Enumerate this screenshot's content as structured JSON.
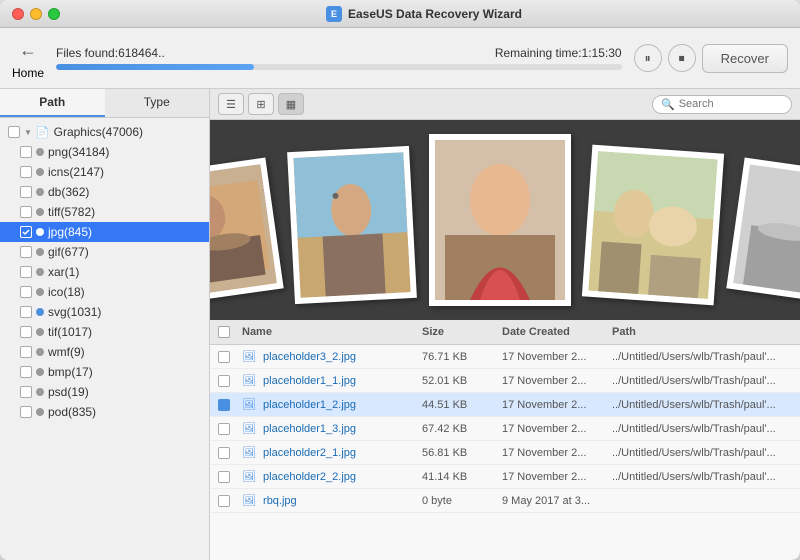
{
  "window": {
    "title": "EaseUS Data Recovery Wizard",
    "title_icon": "E"
  },
  "topbar": {
    "back_label": "←",
    "home_label": "Home",
    "files_found_label": "Files found:",
    "files_found_value": "618464..",
    "remaining_label": "Remaining time:",
    "remaining_value": "1:15:30",
    "progress_percent": 35,
    "pause_label": "⏸",
    "stop_label": "⏹",
    "recover_label": "Recover"
  },
  "sidebar": {
    "tab_path": "Path",
    "tab_type": "Type",
    "items": [
      {
        "label": "Graphics(47006)",
        "indent": 0,
        "type": "parent",
        "icon": "📄",
        "has_arrow": true
      },
      {
        "label": "png(34184)",
        "indent": 1,
        "type": "child",
        "dot_color": "#999"
      },
      {
        "label": "icns(2147)",
        "indent": 1,
        "type": "child",
        "dot_color": "#999"
      },
      {
        "label": "db(362)",
        "indent": 1,
        "type": "child",
        "dot_color": "#999"
      },
      {
        "label": "tiff(5782)",
        "indent": 1,
        "type": "child",
        "dot_color": "#999"
      },
      {
        "label": "jpg(845)",
        "indent": 1,
        "type": "child",
        "dot_color": "#333",
        "selected": true
      },
      {
        "label": "gif(677)",
        "indent": 1,
        "type": "child",
        "dot_color": "#999"
      },
      {
        "label": "xar(1)",
        "indent": 1,
        "type": "child",
        "dot_color": "#999"
      },
      {
        "label": "ico(18)",
        "indent": 1,
        "type": "child",
        "dot_color": "#999"
      },
      {
        "label": "svg(1031)",
        "indent": 1,
        "type": "child",
        "dot_color": "#4a90e2"
      },
      {
        "label": "tif(1017)",
        "indent": 1,
        "type": "child",
        "dot_color": "#999"
      },
      {
        "label": "wmf(9)",
        "indent": 1,
        "type": "child",
        "dot_color": "#999"
      },
      {
        "label": "bmp(17)",
        "indent": 1,
        "type": "child",
        "dot_color": "#999"
      },
      {
        "label": "psd(19)",
        "indent": 1,
        "type": "child",
        "dot_color": "#999"
      },
      {
        "label": "pod(835)",
        "indent": 1,
        "type": "child",
        "dot_color": "#999"
      }
    ]
  },
  "toolbar": {
    "list_view": "☰",
    "grid_view": "⊞",
    "filmstrip_view": "▦",
    "search_placeholder": "Search"
  },
  "file_list": {
    "headers": {
      "name": "Name",
      "size": "Size",
      "date": "Date Created",
      "path": "Path"
    },
    "rows": [
      {
        "name": "placeholder3_2.jpg",
        "size": "76.71 KB",
        "date": "17 November 2...",
        "path": "../Untitled/Users/wlb/Trash/paul'..."
      },
      {
        "name": "placeholder1_1.jpg",
        "size": "52.01 KB",
        "date": "17 November 2...",
        "path": "../Untitled/Users/wlb/Trash/paul'..."
      },
      {
        "name": "placeholder1_2.jpg",
        "size": "44.51 KB",
        "date": "17 November 2...",
        "path": "../Untitled/Users/wlb/Trash/paul'...",
        "selected": true
      },
      {
        "name": "placeholder1_3.jpg",
        "size": "67.42 KB",
        "date": "17 November 2...",
        "path": "../Untitled/Users/wlb/Trash/paul'..."
      },
      {
        "name": "placeholder2_1.jpg",
        "size": "56.81 KB",
        "date": "17 November 2...",
        "path": "../Untitled/Users/wlb/Trash/paul'..."
      },
      {
        "name": "placeholder2_2.jpg",
        "size": "41.14 KB",
        "date": "17 November 2...",
        "path": "../Untitled/Users/wlb/Trash/paul'..."
      },
      {
        "name": "rbq.jpg",
        "size": "0 byte",
        "date": "9 May 2017 at 3...",
        "path": ""
      }
    ]
  }
}
